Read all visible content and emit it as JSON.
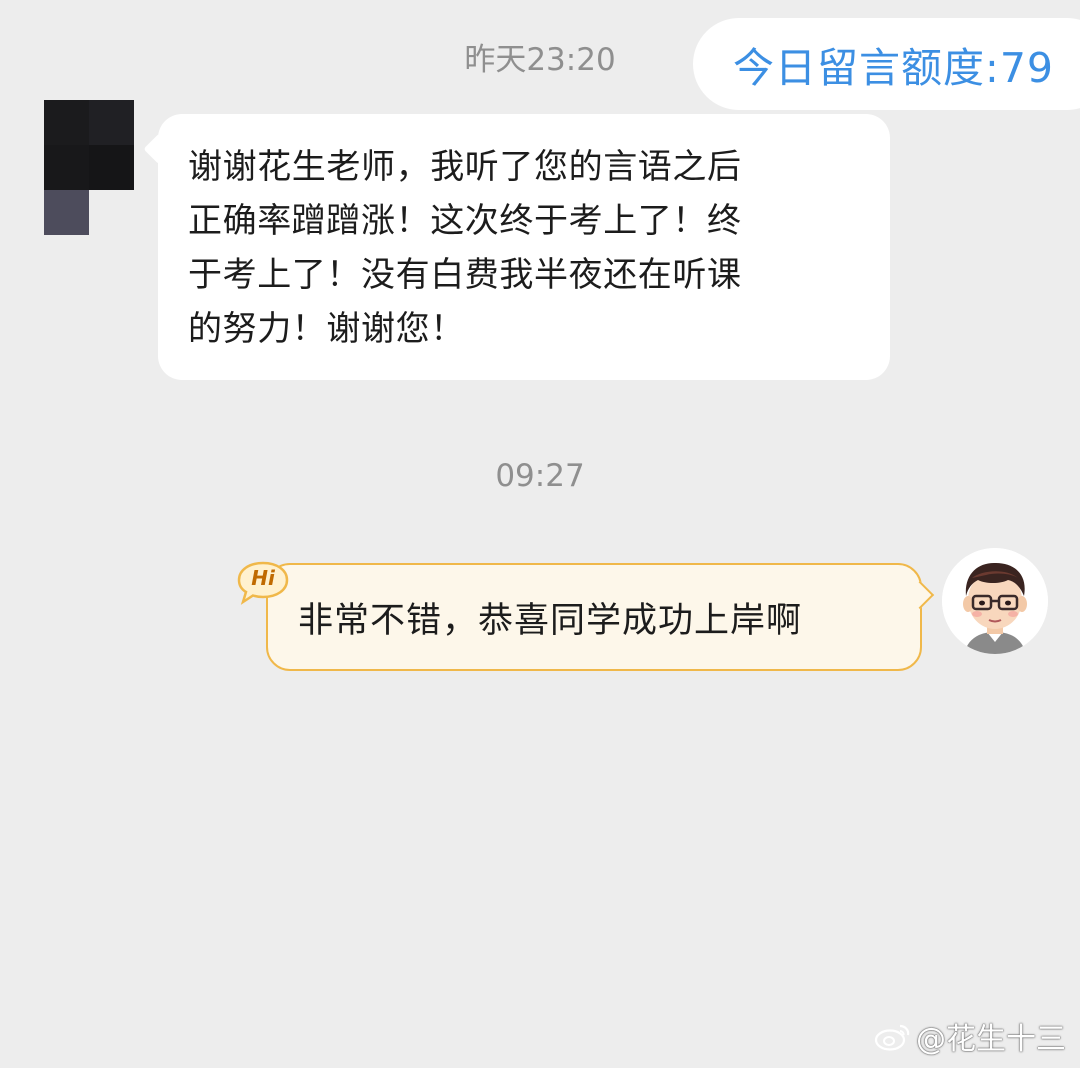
{
  "quota": {
    "label": "今日留言额度:79"
  },
  "timestamps": [
    "昨天23:20",
    "09:27"
  ],
  "incoming_message": {
    "lines": [
      "谢谢花生老师，我听了您的言语之后",
      "正确率蹭蹭涨！这次终于考上了！终",
      "于考上了！没有白费我半夜还在听课",
      "的努力！谢谢您！"
    ]
  },
  "outgoing_message": {
    "text": "非常不错，恭喜同学成功上岸啊",
    "badge": "Hi"
  },
  "watermark": {
    "text": "@花生十三",
    "icon": "weibo-icon"
  },
  "colors": {
    "background": "#ededed",
    "accent_blue": "#3c8fe3",
    "outgoing_bg": "#fdf7ea",
    "outgoing_border": "#f0b84a"
  }
}
